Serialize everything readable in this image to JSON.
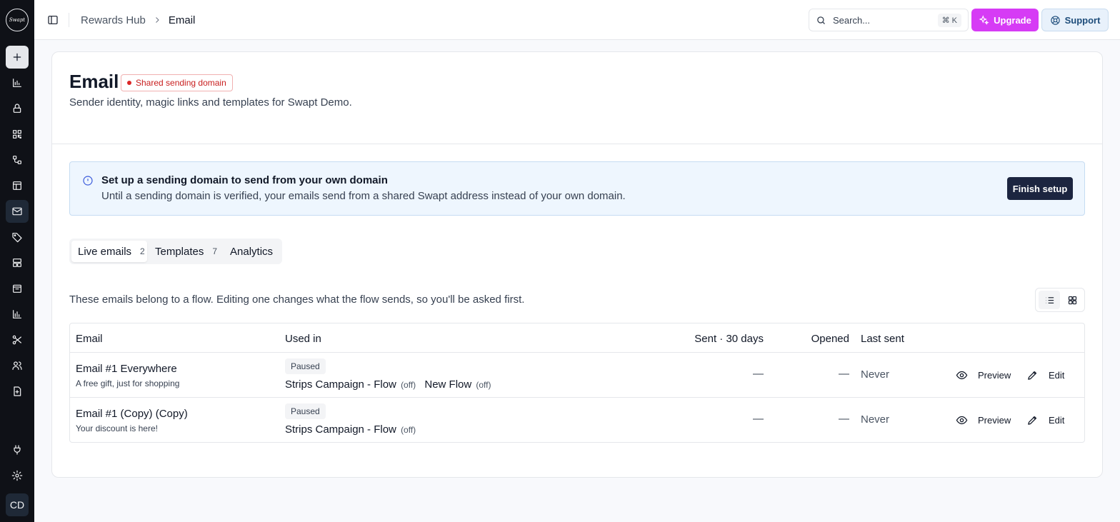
{
  "sidebar": {
    "logo_text": "Swapt",
    "items": [
      "plus-icon",
      "bar-chart-icon",
      "lock-icon",
      "qr-code-icon",
      "workflow-icon",
      "layout-icon",
      "mail-icon",
      "tag-icon",
      "rows-icon",
      "package-icon",
      "analytics-icon",
      "scissors-icon",
      "users-icon",
      "file-plus-icon"
    ],
    "bottom_items": [
      "plug-icon",
      "gear-icon"
    ],
    "avatar": "CD"
  },
  "header": {
    "breadcrumb": [
      "Rewards Hub",
      "Email"
    ],
    "search_placeholder": "Search...",
    "search_shortcut": "⌘ K",
    "upgrade_label": "Upgrade",
    "support_label": "Support"
  },
  "page": {
    "title": "Email",
    "badge": "Shared sending domain",
    "subtitle": "Sender identity, magic links and templates for Swapt Demo."
  },
  "alert": {
    "title": "Set up a sending domain to send from your own domain",
    "text": "Until a sending domain is verified, your emails send from a shared Swapt address instead of your own domain.",
    "button": "Finish setup"
  },
  "tabs": [
    {
      "label": "Live emails",
      "count": "2"
    },
    {
      "label": "Templates",
      "count": "7"
    },
    {
      "label": "Analytics",
      "count": ""
    }
  ],
  "note": "These emails belong to a flow. Editing one changes what the flow sends, so you'll be asked first.",
  "table": {
    "headers": [
      "Email",
      "Used in",
      "Sent · 30 days",
      "Opened",
      "Last sent"
    ],
    "rows": [
      {
        "name": "Email #1 Everywhere",
        "subject": "A free gift, just for shopping",
        "status": "Paused",
        "flows": [
          {
            "name": "Strips Campaign - Flow",
            "state": "(off)"
          },
          {
            "name": "New Flow",
            "state": "(off)"
          }
        ],
        "sent": "—",
        "opened": "—",
        "last_sent": "Never",
        "preview": "Preview",
        "edit": "Edit"
      },
      {
        "name": "Email #1 (Copy) (Copy)",
        "subject": "Your discount is here!",
        "status": "Paused",
        "flows": [
          {
            "name": "Strips Campaign - Flow",
            "state": "(off)"
          }
        ],
        "sent": "—",
        "opened": "—",
        "last_sent": "Never",
        "preview": "Preview",
        "edit": "Edit"
      }
    ]
  },
  "colors": {
    "sidebar": "#0f1117",
    "upgrade": "#d63bf5",
    "support_bg": "#e8f1fb",
    "badge_red": "#c81e1e",
    "alert_bg": "#eef6fe",
    "primary_button": "#1c2540"
  }
}
